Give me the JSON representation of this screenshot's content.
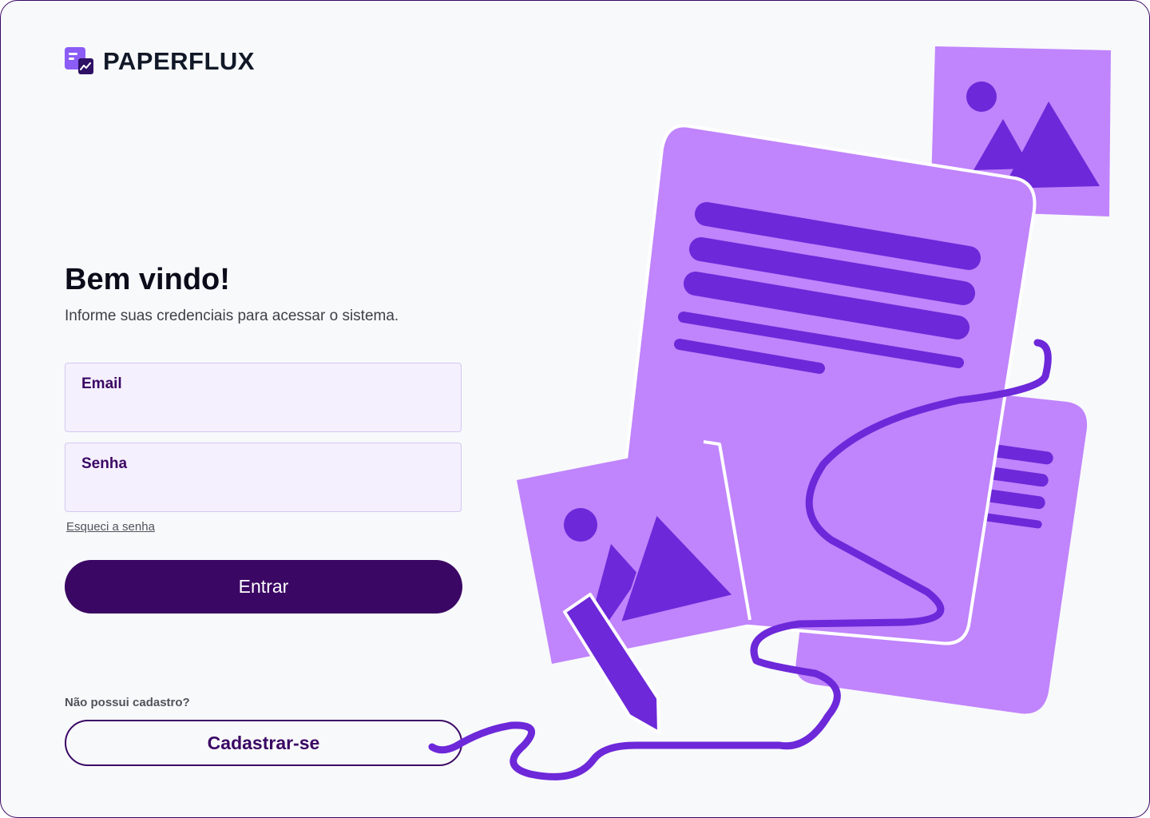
{
  "brand": {
    "name": "PAPERFLUX",
    "logo_icon": "document-chart-icon"
  },
  "welcome": {
    "title": "Bem vindo!",
    "subtitle": "Informe suas credenciais para acessar o sistema."
  },
  "form": {
    "email_label": "Email",
    "email_value": "",
    "password_label": "Senha",
    "password_value": "",
    "forgot_password": "Esqueci a senha",
    "submit_label": "Entrar"
  },
  "signup": {
    "prompt": "Não possui cadastro?",
    "button_label": "Cadastrar-se"
  },
  "colors": {
    "primary": "#3b0764",
    "illustration_light": "#c084fc",
    "illustration_dark": "#6d28d9",
    "field_background": "#f5f0fe",
    "page_background": "#f8f9fb"
  },
  "illustration": {
    "icons": [
      "image-card-icon",
      "document-icon",
      "pencil-icon",
      "scribble-line"
    ]
  }
}
